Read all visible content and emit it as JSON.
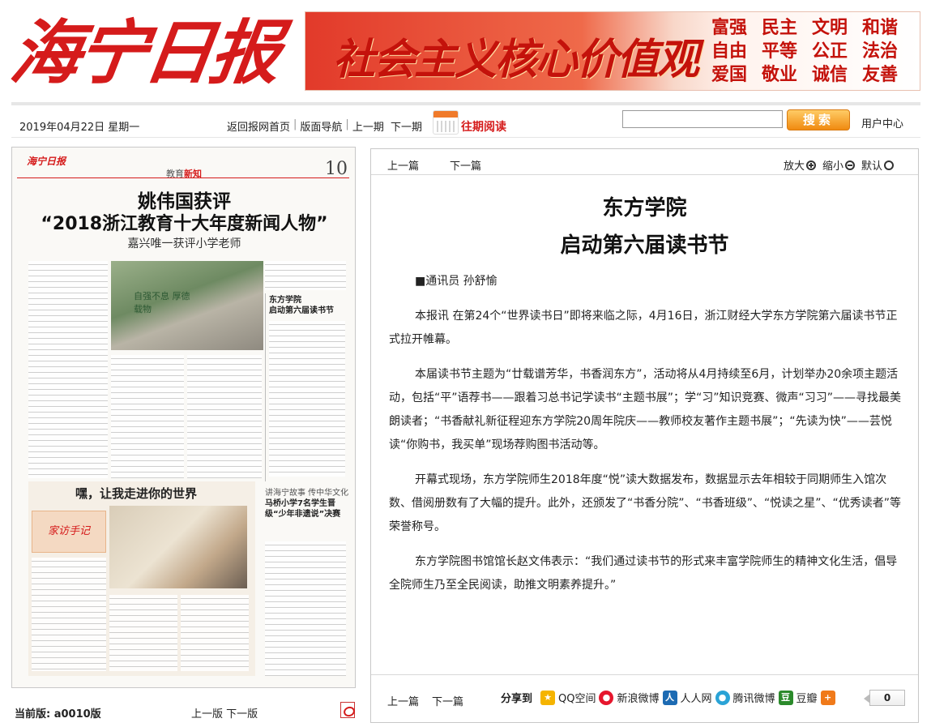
{
  "masthead": {
    "logo": "海宁日报"
  },
  "banner": {
    "slogan": "社会主义核心价值观",
    "words": [
      "富强",
      "民主",
      "文明",
      "和谐",
      "自由",
      "平等",
      "公正",
      "法治",
      "爱国",
      "敬业",
      "诚信",
      "友善"
    ]
  },
  "toolbar": {
    "date": "2019年04月22日 星期一",
    "links": [
      "返回报网首页",
      "版面导航",
      "上一期",
      "下一期"
    ],
    "archive": "往期阅读",
    "search_button": "搜索",
    "user_center": "用户中心"
  },
  "paper": {
    "masthead": "海宁日报",
    "section": "教育",
    "section_em": "新知",
    "page_num": "10",
    "headline1": "姚伟国获评",
    "headline2": "“2018浙江教育十大年度新闻人物”",
    "subhead": "嘉兴唯一获评小学老师",
    "side_title": "东方学院\n启动第六届读书节",
    "sec2_title": "嘿，让我走进你的世界",
    "sec2_tag": "家访手记",
    "side2_t1": "讲海宁故事 传中华文化",
    "side2_t2": "马桥小学7名学生晋级“少年非遗说”决赛"
  },
  "footer_left": {
    "label": "当前版:   a0010版",
    "nav": "上一版  下一版"
  },
  "article": {
    "nav_prev": "上一篇",
    "nav_next": "下一篇",
    "zoom_in": "放大",
    "zoom_out": "缩小",
    "zoom_default": "默认",
    "title1": "东方学院",
    "title2": "启动第六届读书节",
    "author": "■通讯员 孙舒愉",
    "paragraphs": [
      "本报讯 在第24个“世界读书日”即将来临之际，4月16日，浙江财经大学东方学院第六届读书节正式拉开帷幕。",
      "本届读书节主题为“廿载谱芳华，书香润东方”，活动将从4月持续至6月，计划举办20余项主题活动，包括“平”语荐书——跟着习总书记学读书“主题书展”；学“习”知识竞赛、微声“习习”——寻找最美朗读者；“书香献礼新征程迎东方学院20周年院庆——教师校友著作主题书展”；“先读为快”——芸悦读“你购书，我买单”现场荐购图书活动等。",
      "开幕式现场，东方学院师生2018年度“悦”读大数据发布，数据显示去年相较于同期师生入馆次数、借阅册数有了大幅的提升。此外，还颁发了“书香分院”、“书香班级”、“悦读之星”、“优秀读者”等荣誉称号。",
      "东方学院图书馆馆长赵文伟表示：“我们通过读书节的形式来丰富学院师生的精神文化生活，倡导全院师生乃至全民阅读，助推文明素养提升。”"
    ],
    "share_label": "分享到",
    "share_items": [
      "QQ空间",
      "新浪微博",
      "人人网",
      "腾讯微博",
      "豆瓣"
    ],
    "share_count": "0"
  }
}
